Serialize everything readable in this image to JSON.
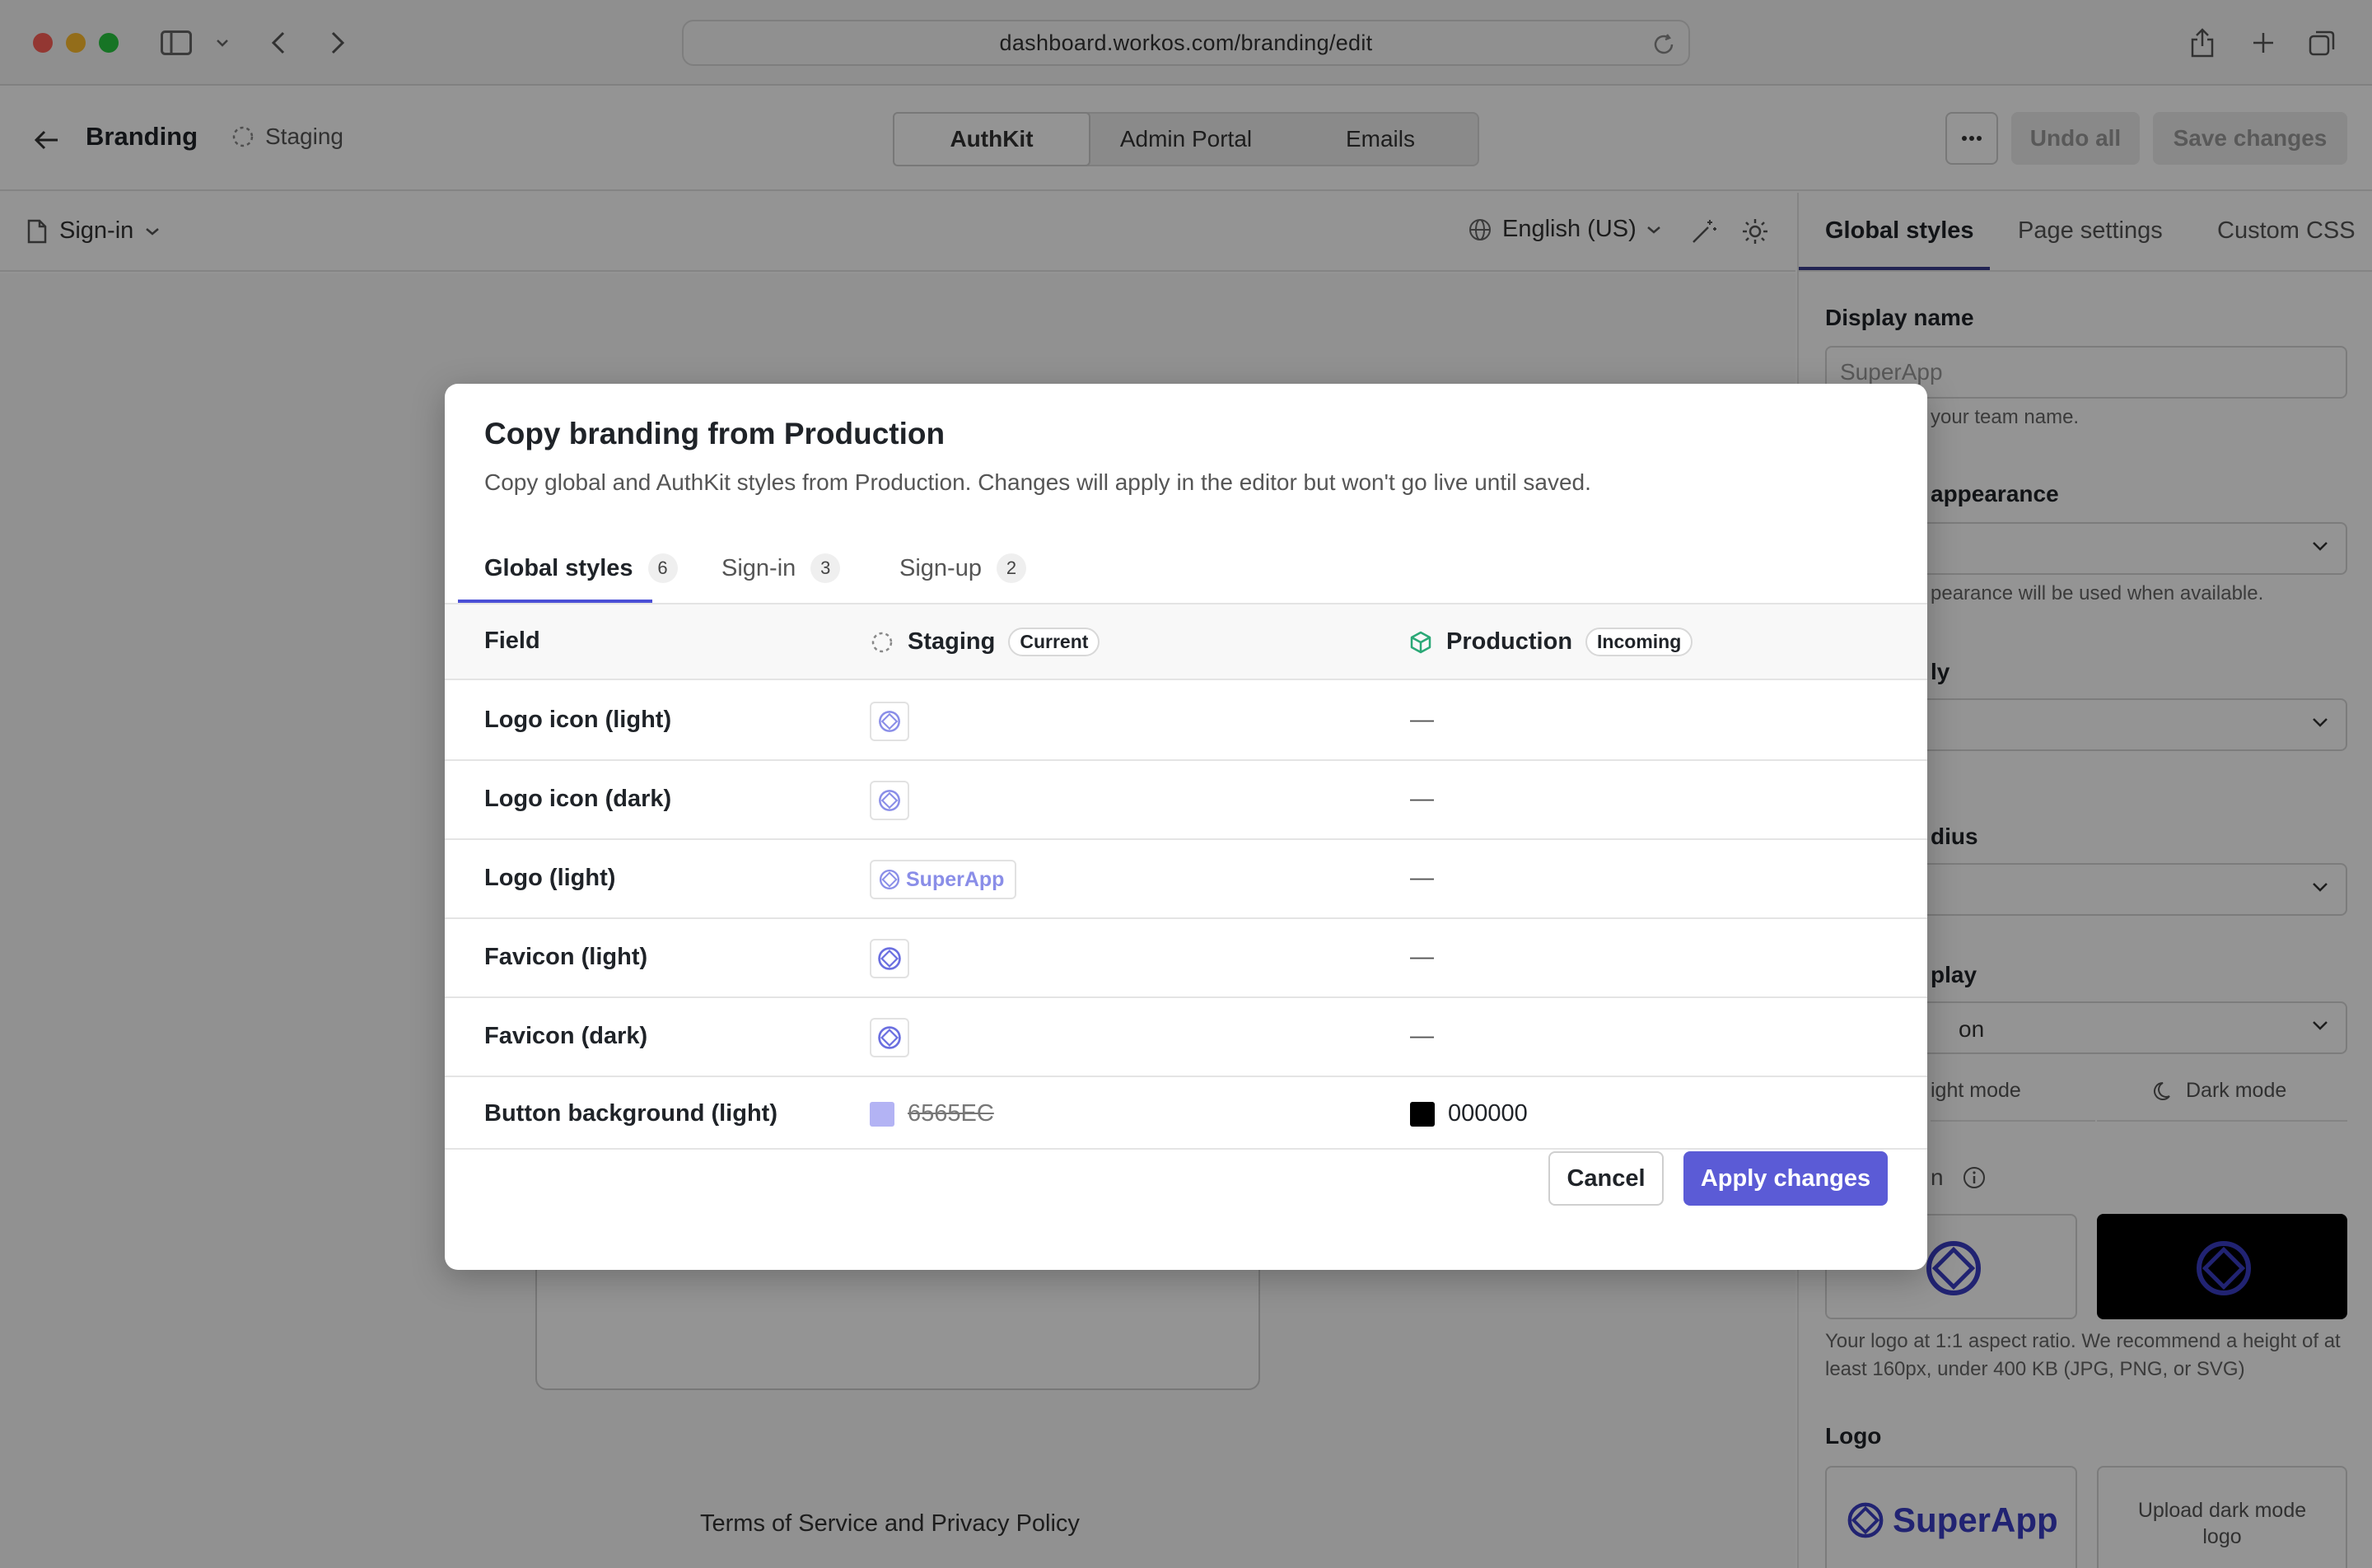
{
  "browser": {
    "url": "dashboard.workos.com/branding/edit",
    "traffic_lights": [
      "#fe5f57",
      "#febc2e",
      "#28c840"
    ]
  },
  "header": {
    "title": "Branding",
    "environment": "Staging",
    "segments": [
      "AuthKit",
      "Admin Portal",
      "Emails"
    ],
    "active_segment": "AuthKit",
    "more_label": "···",
    "undo_label": "Undo all",
    "save_label": "Save changes"
  },
  "subbar": {
    "page_selector": "Sign-in",
    "language": "English (US)"
  },
  "preview": {
    "terms_text": "Terms of Service and Privacy Policy"
  },
  "panel": {
    "tabs": [
      "Global styles",
      "Page settings",
      "Custom CSS"
    ],
    "active_tab": "Global styles",
    "display_name_label": "Display name",
    "display_name_value": "SuperApp",
    "display_name_help": "your team name.",
    "appearance_label": "appearance",
    "appearance_help": "pearance will be used when available.",
    "family_label": "ly",
    "radius_label": "dius",
    "display_label": "play",
    "display_value": "on",
    "light_mode_label": "ight mode",
    "dark_mode_label": "Dark mode",
    "icon_label_partial": "n",
    "icon_help": "Your logo at 1:1 aspect ratio. We recommend a height of at least 160px, under 400 KB (JPG, PNG, or SVG)",
    "logo_label": "Logo",
    "logo_text": "SuperApp",
    "upload_dark_label": "Upload dark mode logo"
  },
  "modal": {
    "title": "Copy branding from Production",
    "subtitle": "Copy global and AuthKit styles from Production. Changes will apply in the editor but won't go live until saved.",
    "tabs": [
      {
        "label": "Global styles",
        "count": "6"
      },
      {
        "label": "Sign-in",
        "count": "3"
      },
      {
        "label": "Sign-up",
        "count": "2"
      }
    ],
    "active_tab": "Global styles",
    "columns": {
      "field": "Field",
      "staging": "Staging",
      "staging_tag": "Current",
      "production": "Production",
      "production_tag": "Incoming"
    },
    "rows": [
      {
        "field": "Logo icon (light)",
        "staging": "icon",
        "production": "—"
      },
      {
        "field": "Logo icon (dark)",
        "staging": "icon",
        "production": "—"
      },
      {
        "field": "Logo (light)",
        "staging": "SuperApp",
        "production": "—"
      },
      {
        "field": "Favicon (light)",
        "staging": "icon",
        "production": "—"
      },
      {
        "field": "Favicon (dark)",
        "staging": "icon",
        "production": "—"
      },
      {
        "field": "Button background (light)",
        "staging": "6565EC",
        "production": "000000"
      }
    ],
    "staging_color": "#6565EC",
    "production_color": "#000000",
    "cancel_label": "Cancel",
    "apply_label": "Apply changes",
    "accent": "#5b5bd6"
  }
}
